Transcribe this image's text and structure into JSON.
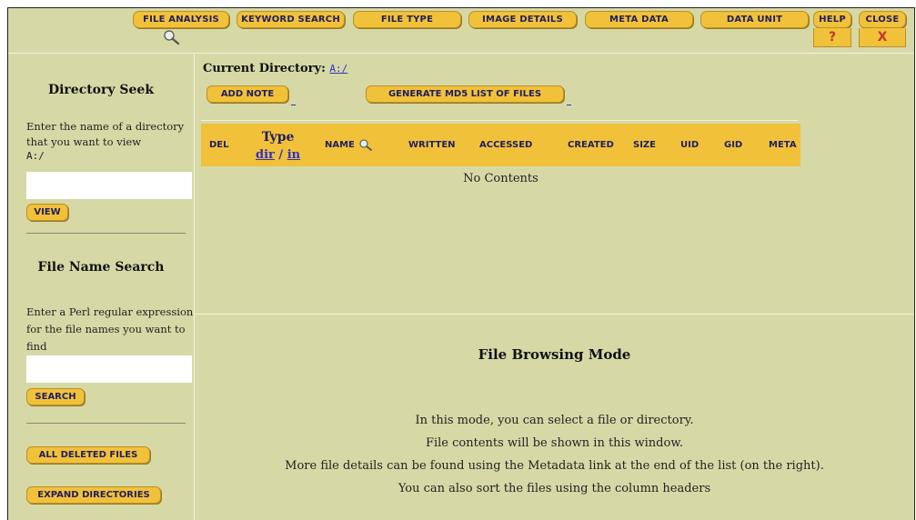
{
  "topnav": {
    "tabs": [
      {
        "label": "File Analysis"
      },
      {
        "label": "Keyword Search"
      },
      {
        "label": "File Type"
      },
      {
        "label": "Image Details"
      },
      {
        "label": "Meta Data"
      },
      {
        "label": "Data Unit"
      },
      {
        "label": "Help"
      },
      {
        "label": "Close"
      }
    ],
    "help_glyph": "?",
    "close_glyph": "X",
    "search_icon": "magnifier-icon"
  },
  "sidebar": {
    "directory_seek": {
      "heading": "Directory Seek",
      "instruction_line1": "Enter the name of a directory",
      "instruction_line2": "that you want to view",
      "current_value": "A:/",
      "input_value": "",
      "button_label": "View"
    },
    "file_name_search": {
      "heading": "File Name Search",
      "instruction_line1": "Enter a Perl regular expression",
      "instruction_line2": "for the file names you want to",
      "instruction_line3": "find",
      "input_value": "",
      "button_label": "Search"
    },
    "all_deleted_button": "All Deleted Files",
    "expand_dirs_button": "Expand Directories"
  },
  "main": {
    "current_directory_label": "Current Directory:",
    "current_directory_value": "A:/",
    "add_note_button": "Add Note",
    "md5_button": "Generate MD5 List of Files",
    "columns": {
      "del": "Del",
      "type": "Type",
      "type_dir": "dir",
      "type_sep": " / ",
      "type_in": "in",
      "name": "Name",
      "written": "Written",
      "accessed": "Accessed",
      "created": "Created",
      "size": "Size",
      "uid": "UID",
      "gid": "GID",
      "meta": "Meta"
    },
    "empty_message": "No Contents"
  },
  "browsing": {
    "title": "File Browsing Mode",
    "line1": "In this mode, you can select a file or directory.",
    "line2": "File contents will be shown in this window.",
    "line3": "More file details can be found using the Metadata link at the end of the list (on the right).",
    "line4": "You can also sort the files using the column headers"
  },
  "colors": {
    "background": "#d6d9a6",
    "button": "#f2c13a",
    "button_text": "#202060",
    "link": "#3030c0"
  }
}
